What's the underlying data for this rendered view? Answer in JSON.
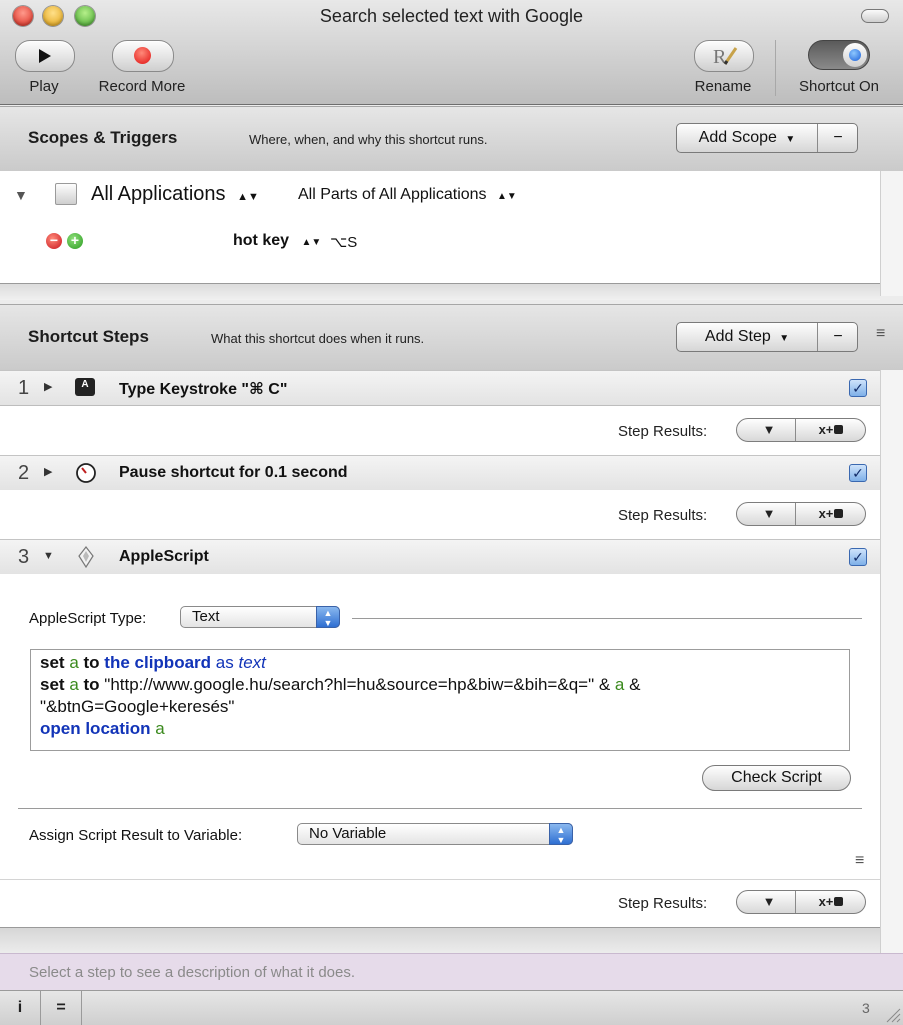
{
  "window": {
    "title": "Search selected text with Google"
  },
  "toolbar": {
    "play_label": "Play",
    "record_label": "Record More",
    "rename_label": "Rename",
    "shortcut_label": "Shortcut On"
  },
  "scopes": {
    "title": "Scopes & Triggers",
    "description": "Where, when, and why this shortcut runs.",
    "add_label": "Add Scope",
    "remove_label": "−",
    "scope_app": "All Applications",
    "scope_parts": "All Parts of All Applications",
    "trigger_type": "hot key",
    "trigger_value": "⌥S"
  },
  "steps_section": {
    "title": "Shortcut Steps",
    "description": "What this shortcut does when it runs.",
    "add_label": "Add Step",
    "remove_label": "−"
  },
  "steps": [
    {
      "number": "1",
      "title": "Type Keystroke \"⌘ C\"",
      "icon": "keyboard-icon",
      "enabled": true
    },
    {
      "number": "2",
      "title": "Pause shortcut for 0.1 second",
      "icon": "timer-icon",
      "enabled": true
    },
    {
      "number": "3",
      "title": "AppleScript",
      "icon": "applescript-icon",
      "enabled": true
    }
  ],
  "step_results_label": "Step Results:",
  "step_results_buttons": {
    "filter": "▼",
    "variable": "x+"
  },
  "applescript": {
    "type_label": "AppleScript Type:",
    "type_value": "Text",
    "line1": {
      "kw1": "set",
      "var1": "a",
      "kw2": "to",
      "app": "the clipboard",
      "as": "as",
      "type": "text"
    },
    "line2": {
      "kw1": "set",
      "var1": "a",
      "kw2": "to",
      "str": "\"http://www.google.hu/search?hl=hu&source=hp&biw=&bih=&q=\"",
      "amp1": "&",
      "var2": "a",
      "amp2": "&"
    },
    "line3": {
      "str": "\"&btnG=Google+keresés\""
    },
    "line4": {
      "app": "open location",
      "var": "a"
    },
    "check_label": "Check Script",
    "assign_label": "Assign Script Result to Variable:",
    "assign_value": "No Variable"
  },
  "status": {
    "hint": "Select a step to see a description of what it does.",
    "info_button": "i",
    "equals_button": "=",
    "count": "3"
  }
}
